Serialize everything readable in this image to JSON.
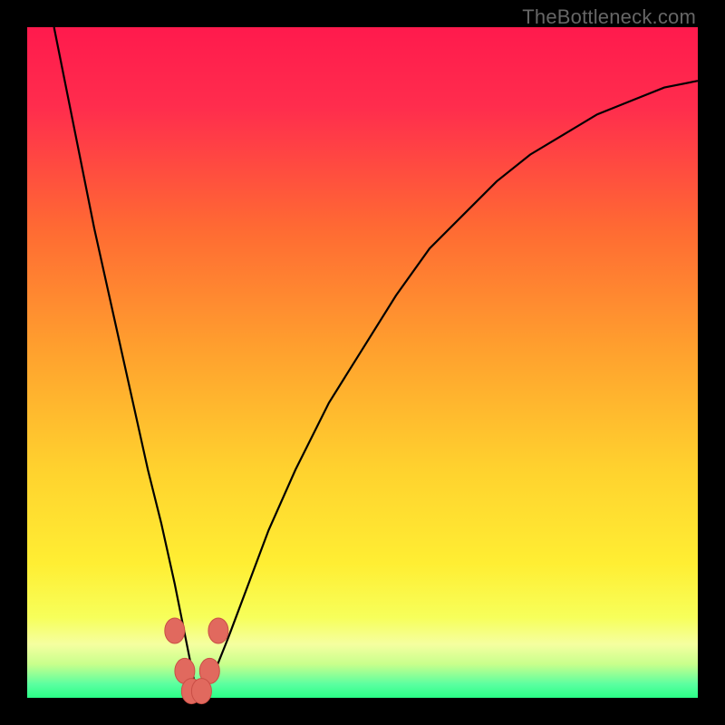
{
  "watermark": "TheBottleneck.com",
  "colors": {
    "bg_frame": "#000000",
    "gradient_stops": [
      {
        "pct": 0,
        "color": "#ff1a4d"
      },
      {
        "pct": 12,
        "color": "#ff2d4d"
      },
      {
        "pct": 30,
        "color": "#ff6a33"
      },
      {
        "pct": 48,
        "color": "#ffa02e"
      },
      {
        "pct": 66,
        "color": "#ffd22e"
      },
      {
        "pct": 80,
        "color": "#ffee33"
      },
      {
        "pct": 88,
        "color": "#f7ff5a"
      },
      {
        "pct": 92,
        "color": "#f5ffa0"
      },
      {
        "pct": 95,
        "color": "#c8ff8c"
      },
      {
        "pct": 98,
        "color": "#5affa0"
      },
      {
        "pct": 100,
        "color": "#2aff87"
      }
    ],
    "curve": "#000000",
    "bead_fill": "#e1695e",
    "bead_stroke": "#c94e45"
  },
  "chart_data": {
    "type": "line",
    "title": "",
    "xlabel": "",
    "ylabel": "",
    "xlim": [
      0,
      100
    ],
    "ylim": [
      0,
      100
    ],
    "note": "V-shaped bottleneck curve; y is the curve height read off the image (0 at bottom green band, 100 at top). Minimum near x≈25, y≈0.",
    "series": [
      {
        "name": "curve",
        "x": [
          4,
          6,
          8,
          10,
          12,
          14,
          16,
          18,
          20,
          22,
          23,
          24,
          25,
          26,
          27,
          28,
          30,
          33,
          36,
          40,
          45,
          50,
          55,
          60,
          65,
          70,
          75,
          80,
          85,
          90,
          95,
          100
        ],
        "values": [
          100,
          90,
          80,
          70,
          61,
          52,
          43,
          34,
          26,
          17,
          12,
          7,
          2,
          1,
          2,
          4,
          9,
          17,
          25,
          34,
          44,
          52,
          60,
          67,
          72,
          77,
          81,
          84,
          87,
          89,
          91,
          92
        ]
      }
    ],
    "markers": [
      {
        "x": 22.0,
        "y": 10,
        "label": "bead"
      },
      {
        "x": 28.5,
        "y": 10,
        "label": "bead"
      },
      {
        "x": 23.5,
        "y": 4,
        "label": "bead"
      },
      {
        "x": 27.2,
        "y": 4,
        "label": "bead"
      },
      {
        "x": 24.5,
        "y": 1,
        "label": "bead"
      },
      {
        "x": 26.0,
        "y": 1,
        "label": "bead"
      }
    ]
  }
}
